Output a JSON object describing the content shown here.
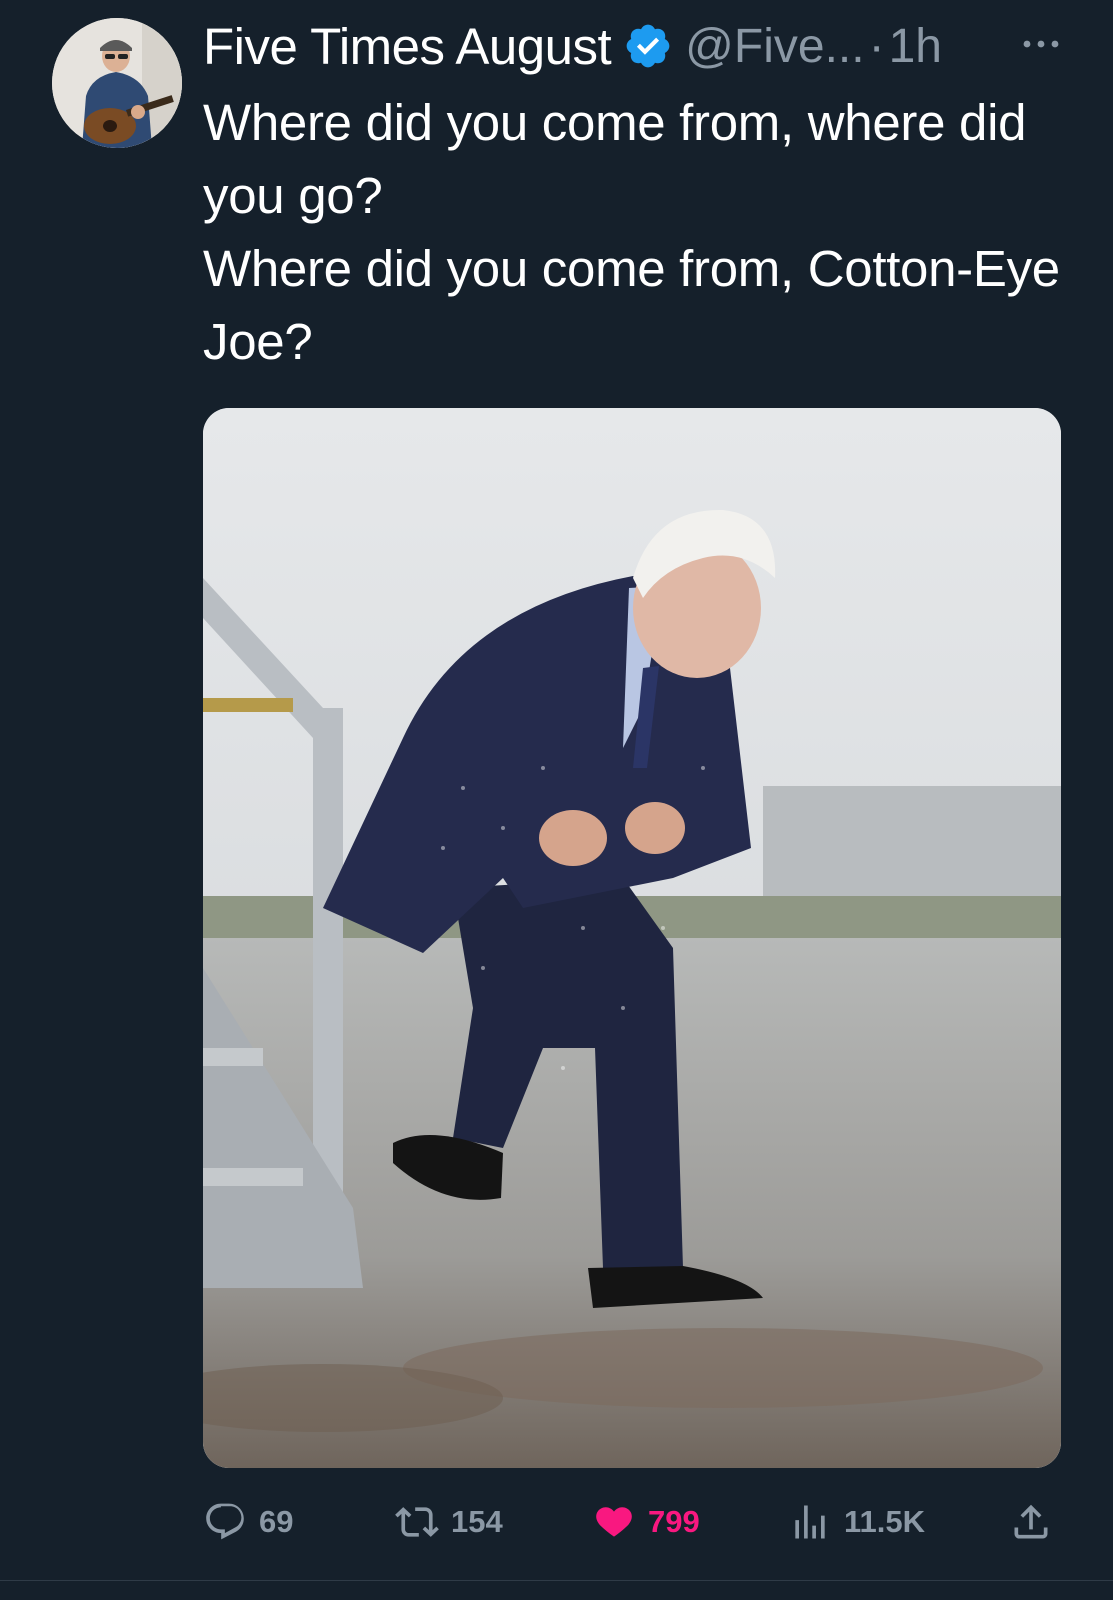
{
  "tweet": {
    "display_name": "Five Times August",
    "verified": true,
    "handle": "@Five...",
    "separator": "·",
    "time": "1h",
    "text_lines": [
      "Where did you come from, where did you go?",
      "Where did you come from, Cotton-Eye Joe?"
    ]
  },
  "actions": {
    "replies": "69",
    "retweets": "154",
    "likes": "799",
    "views": "11.5K"
  },
  "icons": {
    "more": "more-horizontal-icon",
    "reply": "reply-bubble-icon",
    "retweet": "retweet-icon",
    "like": "heart-icon",
    "views": "views-bar-icon",
    "share": "share-upload-icon",
    "verified": "verified-badge-icon"
  },
  "colors": {
    "background": "#15202b",
    "text": "#ffffff",
    "secondary_text": "#8b98a5",
    "verified_blue": "#1d9bf0",
    "like_pink": "#f91880"
  }
}
